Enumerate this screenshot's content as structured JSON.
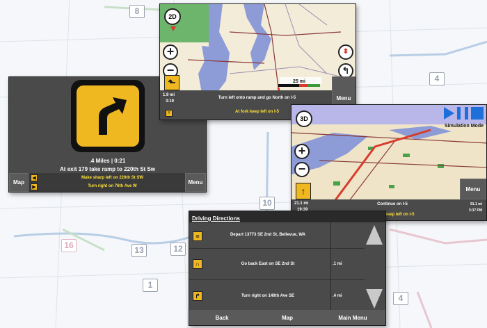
{
  "shields": [
    "8",
    "4",
    "4",
    "10",
    "13",
    "12",
    "1",
    "4",
    "16"
  ],
  "win_turn": {
    "distance_time": ".4 Miles | 0:21",
    "instruction": "At exit 179 take ramp to 220th St Sw",
    "map_label": "Map",
    "menu_label": "Menu",
    "next_1": "Make sharp left on 220th St SW",
    "next_2": "Turn right on 76th Ave W",
    "arrow_icon": "bear-right-arrow-icon"
  },
  "win_map2d": {
    "mode": "2D",
    "scale": "25 mi",
    "dist": "1.9 mi",
    "time": "3:19",
    "instruction": "Turn left onto ramp and go North on I-5",
    "next": "At fork keep left on I-5",
    "menu_label": "Menu"
  },
  "win_map3d": {
    "mode": "3D",
    "sim_label": "Simulation Mode",
    "dist": "21.1 mi",
    "time": "19:39",
    "instruction": "Continue on I-5",
    "next": "At fork keep left on I-5",
    "menu_label": "Menu",
    "eta_dist": "91.1 mi",
    "eta_time": "5:37 PM"
  },
  "win_directions": {
    "title": "Driving Directions",
    "rows": [
      {
        "icon": "depart-icon",
        "text": "Depart 13773 SE 2nd St, Bellevue, WA",
        "dist": ""
      },
      {
        "icon": "u-turn-icon",
        "text": "Go back East on SE 2nd St",
        "dist": ".1 mi"
      },
      {
        "icon": "turn-right-icon",
        "text": "Turn right on 140th Ave SE",
        "dist": ".4 mi"
      }
    ],
    "footer": {
      "back": "Back",
      "map": "Map",
      "main_menu": "Main Menu"
    }
  },
  "colors": {
    "accent": "#f0b820",
    "panel": "#4a4a4a",
    "next_text": "#ffe13a",
    "sim_blue": "#1e6fd8",
    "map_land": "#f3ecd8",
    "water": "#8d9bd6"
  }
}
